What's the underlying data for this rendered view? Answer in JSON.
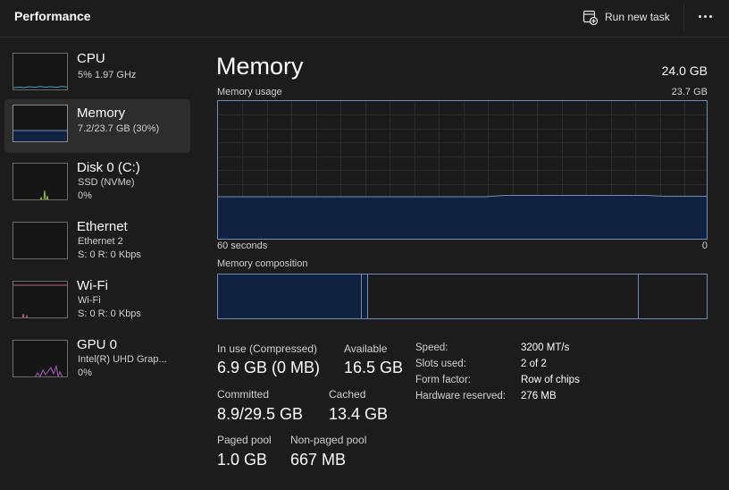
{
  "header": {
    "title": "Performance",
    "run_new_task": "Run new task"
  },
  "sidebar": {
    "items": [
      {
        "name": "CPU",
        "sub1": "5% 1.97 GHz",
        "sub2": ""
      },
      {
        "name": "Memory",
        "sub1": "7.2/23.7 GB (30%)",
        "sub2": ""
      },
      {
        "name": "Disk 0 (C:)",
        "sub1": "SSD (NVMe)",
        "sub2": "0%"
      },
      {
        "name": "Ethernet",
        "sub1": "Ethernet 2",
        "sub2": "S: 0 R: 0 Kbps"
      },
      {
        "name": "Wi-Fi",
        "sub1": "Wi-Fi",
        "sub2": "S: 0 R: 0 Kbps"
      },
      {
        "name": "GPU 0",
        "sub1": "Intel(R) UHD Grap...",
        "sub2": "0%"
      }
    ]
  },
  "main": {
    "title": "Memory",
    "total": "24.0 GB",
    "usage_label": "Memory usage",
    "usage_max": "23.7 GB",
    "time_left": "60 seconds",
    "time_right": "0",
    "composition_label": "Memory composition",
    "stats": {
      "in_use_label": "In use (Compressed)",
      "in_use_value": "6.9 GB (0 MB)",
      "available_label": "Available",
      "available_value": "16.5 GB",
      "committed_label": "Committed",
      "committed_value": "8.9/29.5 GB",
      "cached_label": "Cached",
      "cached_value": "13.4 GB",
      "paged_label": "Paged pool",
      "paged_value": "1.0 GB",
      "nonpaged_label": "Non-paged pool",
      "nonpaged_value": "667 MB"
    },
    "details": [
      {
        "label": "Speed:",
        "value": "3200 MT/s"
      },
      {
        "label": "Slots used:",
        "value": "2 of 2"
      },
      {
        "label": "Form factor:",
        "value": "Row of chips"
      },
      {
        "label": "Hardware reserved:",
        "value": "276 MB"
      }
    ]
  },
  "colors": {
    "background": "#1c1c1c",
    "memory_accent": "#6f8db8",
    "memory_fill": "#112240",
    "cpu_line": "#3fa7c4",
    "disk_line": "#8ec641",
    "wifi_line": "#c0608c",
    "gpu_line": "#b454c8"
  },
  "icons": {
    "run_new_task": "run-task-icon",
    "more": "more-options-icon"
  }
}
